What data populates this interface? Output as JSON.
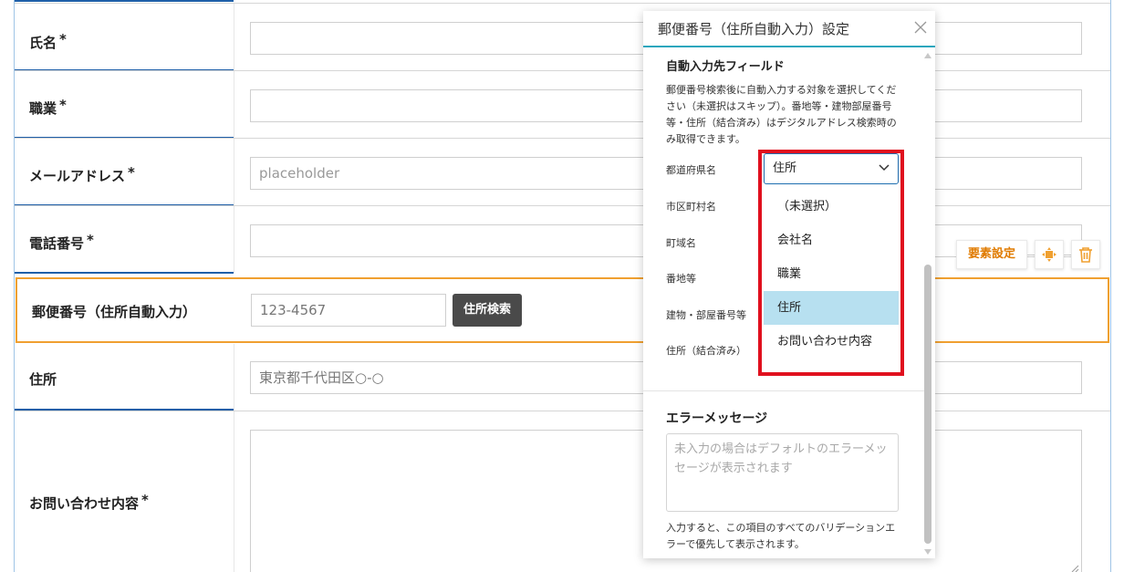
{
  "form": {
    "rows": [
      {
        "label": "氏名",
        "required": "*"
      },
      {
        "label": "職業",
        "required": "*"
      },
      {
        "label": "メールアドレス",
        "required": "*",
        "placeholder": "placeholder"
      },
      {
        "label": "電話番号",
        "required": "*"
      },
      {
        "label": "郵便番号（住所自動入力）",
        "value": "123-4567",
        "button": "住所検索"
      },
      {
        "label": "住所",
        "value": "東京都千代田区○-○"
      },
      {
        "label": "お問い合わせ内容",
        "required": "*"
      }
    ]
  },
  "toolbar": {
    "settings_label": "要素設定",
    "move_icon": "move-icon",
    "delete_icon": "trash-icon"
  },
  "panel": {
    "title": "郵便番号（住所自動入力）設定",
    "close_icon": "close-icon",
    "autofill_title": "自動入力先フィールド",
    "autofill_desc": "郵便番号検索後に自動入力する対象を選択してください（未選択はスキップ）。番地等・建物部屋番号等・住所（結合済み）はデジタルアドレス検索時のみ取得できます。",
    "fields": [
      "都道府県名",
      "市区町村名",
      "町域名",
      "番地等",
      "建物・部屋番号等",
      "住所（結合済み）"
    ],
    "select_value": "住所",
    "options": [
      "（未選択）",
      "会社名",
      "職業",
      "住所",
      "お問い合わせ内容"
    ],
    "selected_option": "住所",
    "error_title": "エラーメッセージ",
    "error_placeholder": "未入力の場合はデフォルトのエラーメッセージが表示されます",
    "error_help": "入力すると、この項目のすべてのバリデーションエラーで優先して表示されます。"
  },
  "colors": {
    "accent_blue": "#1f5fa8",
    "highlight_orange": "#f0a030",
    "panel_accent": "#2aa6bd",
    "annotation_red": "#e0101e",
    "selected_option": "#b7e0f0",
    "toolbar_orange": "#e07b00"
  }
}
